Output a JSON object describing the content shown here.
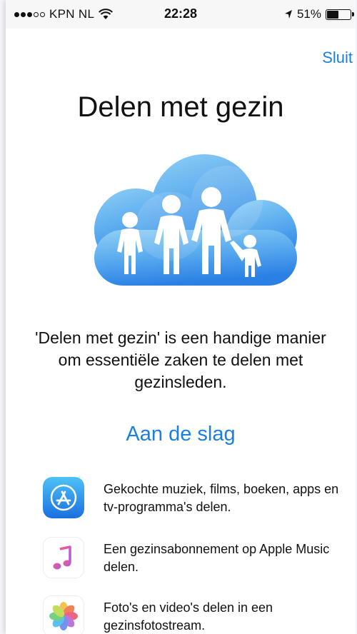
{
  "status_bar": {
    "carrier": "KPN NL",
    "time": "22:28",
    "battery": "51%",
    "battery_level": 0.51
  },
  "nav": {
    "close_label": "Sluit"
  },
  "title": "Delen met gezin",
  "description": "'Delen met gezin' is een handige manier om essentiële zaken te delen met gezinsleden.",
  "get_started_label": "Aan de slag",
  "features": [
    {
      "icon": "app-store-icon",
      "text": "Gekochte muziek, films, boeken, apps en tv-programma's delen."
    },
    {
      "icon": "apple-music-icon",
      "text": "Een gezinsabonnement op Apple Music delen."
    },
    {
      "icon": "photos-icon",
      "text": "Foto's en video's delen in een gezinsfotostream."
    }
  ],
  "colors": {
    "accent": "#1a7fe0",
    "cloud_light": "#7cc4f2",
    "cloud_dark": "#2a86e6"
  }
}
